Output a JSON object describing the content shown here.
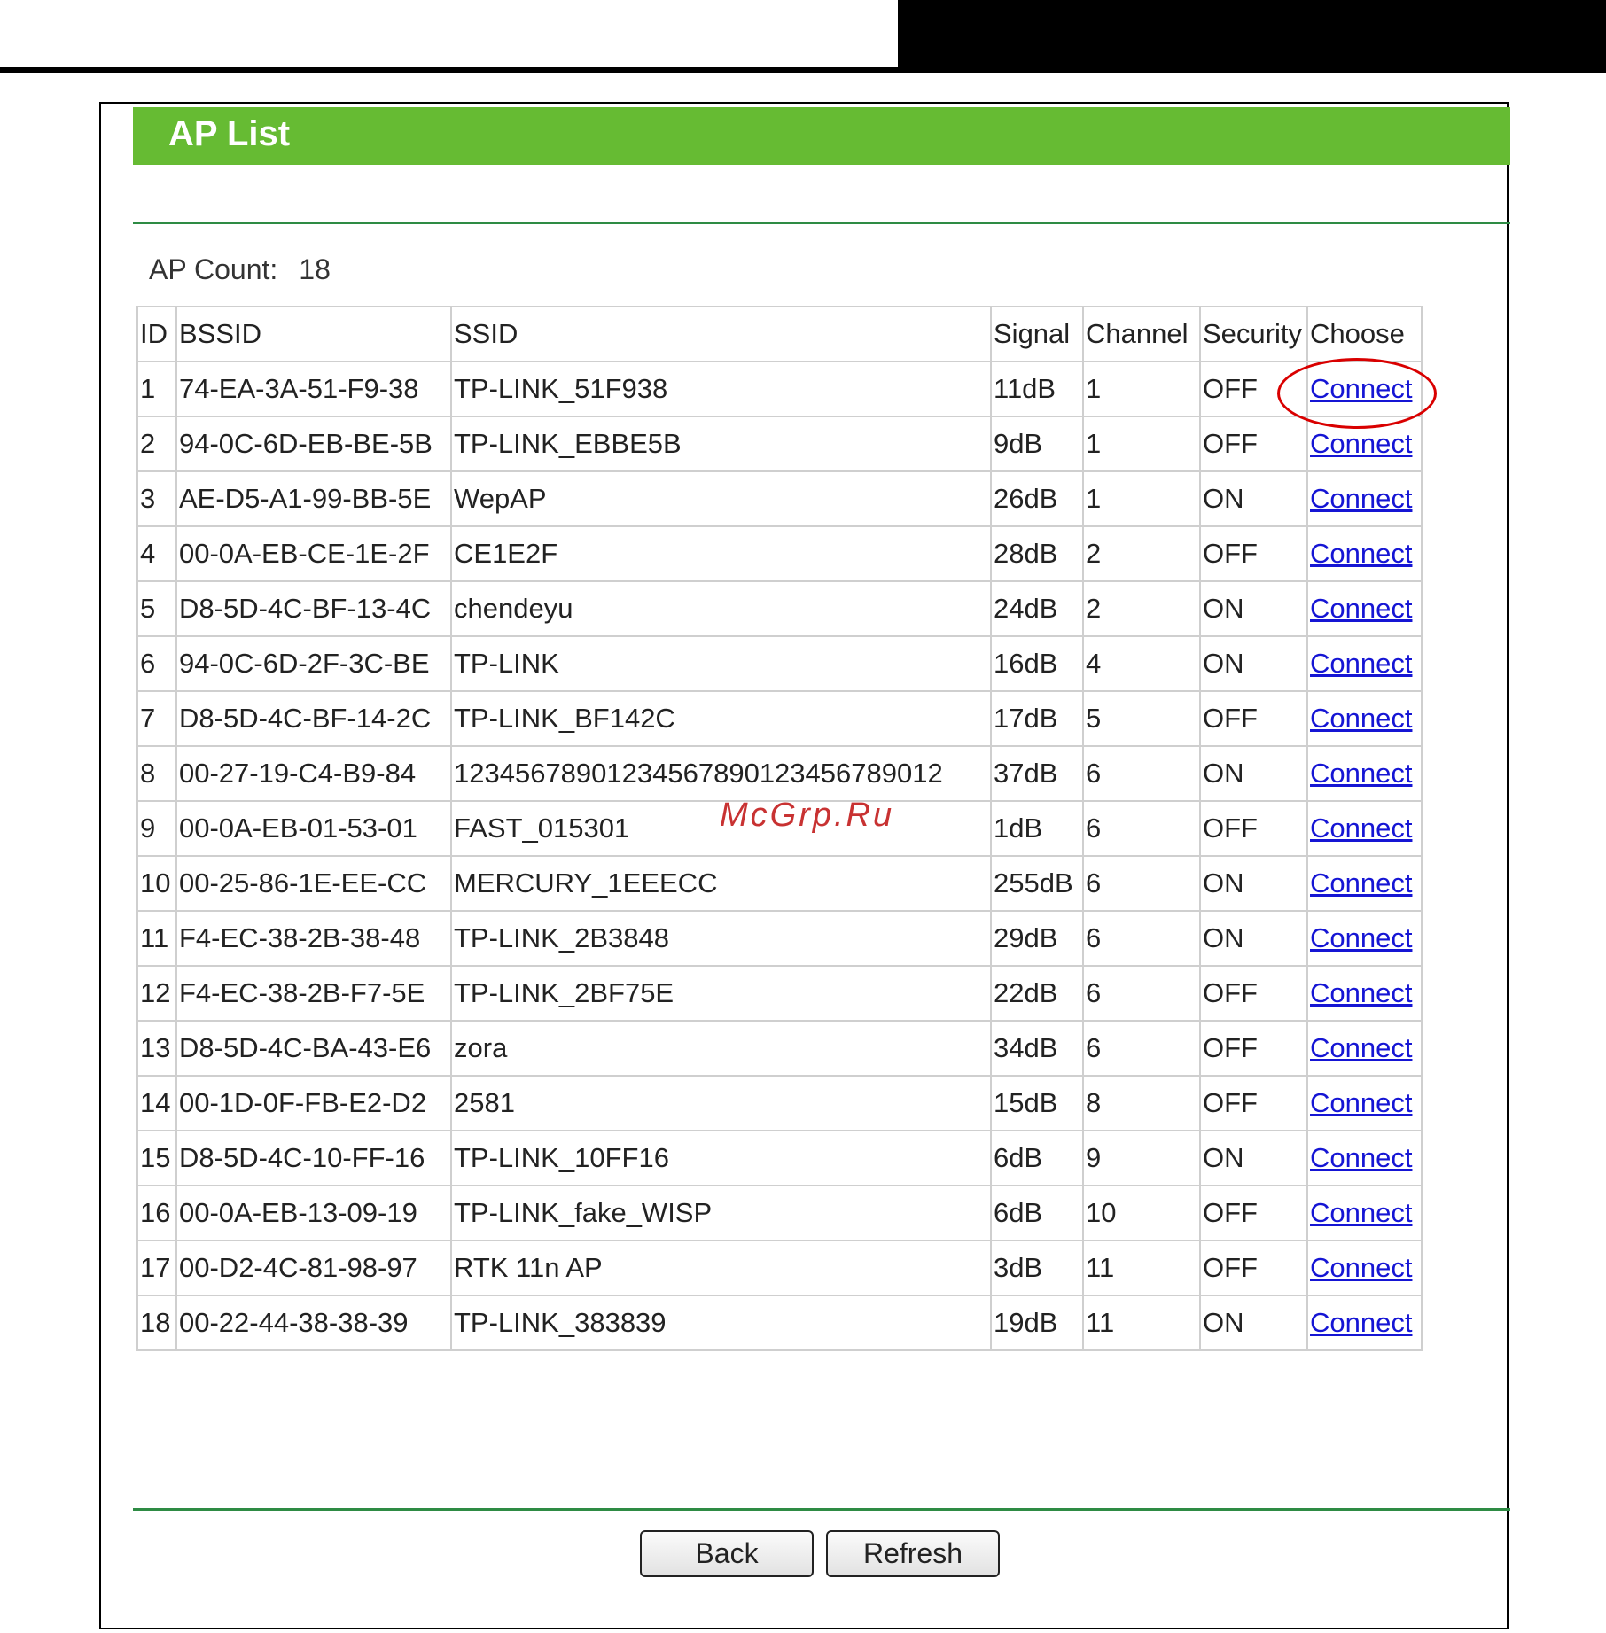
{
  "title": "AP List",
  "ap_count": {
    "label": "AP Count:",
    "value": "18"
  },
  "table": {
    "headers": [
      "ID",
      "BSSID",
      "SSID",
      "Signal",
      "Channel",
      "Security",
      "Choose"
    ],
    "connect_label": "Connect",
    "rows": [
      [
        "1",
        "74-EA-3A-51-F9-38",
        "TP-LINK_51F938",
        "11dB",
        "1",
        "OFF"
      ],
      [
        "2",
        "94-0C-6D-EB-BE-5B",
        "TP-LINK_EBBE5B",
        "9dB",
        "1",
        "OFF"
      ],
      [
        "3",
        "AE-D5-A1-99-BB-5E",
        "WepAP",
        "26dB",
        "1",
        "ON"
      ],
      [
        "4",
        "00-0A-EB-CE-1E-2F",
        "CE1E2F",
        "28dB",
        "2",
        "OFF"
      ],
      [
        "5",
        "D8-5D-4C-BF-13-4C",
        "chendeyu",
        "24dB",
        "2",
        "ON"
      ],
      [
        "6",
        "94-0C-6D-2F-3C-BE",
        "TP-LINK",
        "16dB",
        "4",
        "ON"
      ],
      [
        "7",
        "D8-5D-4C-BF-14-2C",
        "TP-LINK_BF142C",
        "17dB",
        "5",
        "OFF"
      ],
      [
        "8",
        "00-27-19-C4-B9-84",
        "12345678901234567890123456789012",
        "37dB",
        "6",
        "ON"
      ],
      [
        "9",
        "00-0A-EB-01-53-01",
        "FAST_015301",
        "1dB",
        "6",
        "OFF"
      ],
      [
        "10",
        "00-25-86-1E-EE-CC",
        "MERCURY_1EEECC",
        "255dB",
        "6",
        "ON"
      ],
      [
        "11",
        "F4-EC-38-2B-38-48",
        "TP-LINK_2B3848",
        "29dB",
        "6",
        "ON"
      ],
      [
        "12",
        "F4-EC-38-2B-F7-5E",
        "TP-LINK_2BF75E",
        "22dB",
        "6",
        "OFF"
      ],
      [
        "13",
        "D8-5D-4C-BA-43-E6",
        "zora",
        "34dB",
        "6",
        "OFF"
      ],
      [
        "14",
        "00-1D-0F-FB-E2-D2",
        "2581",
        "15dB",
        "8",
        "OFF"
      ],
      [
        "15",
        "D8-5D-4C-10-FF-16",
        "TP-LINK_10FF16",
        "6dB",
        "9",
        "ON"
      ],
      [
        "16",
        "00-0A-EB-13-09-19",
        "TP-LINK_fake_WISP",
        "6dB",
        "10",
        "OFF"
      ],
      [
        "17",
        "00-D2-4C-81-98-97",
        "RTK 11n AP",
        "3dB",
        "11",
        "OFF"
      ],
      [
        "18",
        "00-22-44-38-38-39",
        "TP-LINK_383839",
        "19dB",
        "11",
        "ON"
      ]
    ]
  },
  "buttons": {
    "back": "Back",
    "refresh": "Refresh"
  },
  "watermark": "McGrp.Ru",
  "colors": {
    "title_bar": "#66bb33",
    "rule": "#2e8b44",
    "link": "#1515d4",
    "highlight": "#d90000"
  }
}
